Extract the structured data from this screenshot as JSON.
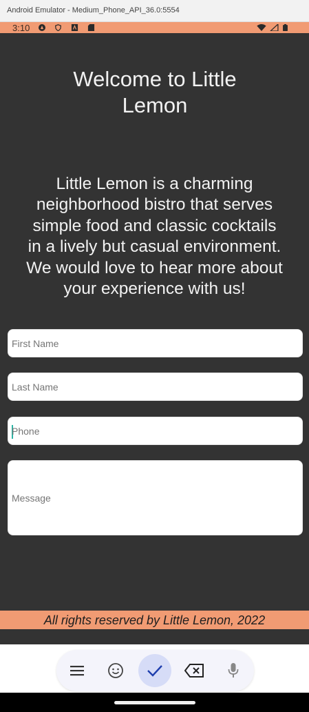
{
  "window": {
    "title": "Android Emulator - Medium_Phone_API_36.0:5554"
  },
  "status_bar": {
    "time": "3:10",
    "color": "#f19b73"
  },
  "screen": {
    "welcome_line1": "Welcome to Little",
    "welcome_line2": "Lemon",
    "intro_lines": [
      "Little Lemon is a charming",
      "neighborhood bistro that serves",
      "simple food and classic cocktails",
      "in a lively but casual environment.",
      "We would love to hear more about",
      "your experience with us!"
    ],
    "fields": {
      "first_name": "First Name",
      "last_name": "Last Name",
      "phone": "Phone",
      "message": "Message"
    },
    "focused_field": "phone",
    "footer": "All rights reserved by Little Lemon, 2022"
  },
  "keyboard_toolbar": {
    "buttons": [
      "menu-icon",
      "emoji-icon",
      "checkmark-icon",
      "backspace-icon",
      "microphone-icon"
    ],
    "accent": "#d6dcf7"
  },
  "colors": {
    "background": "#333333",
    "accent": "#f19b73",
    "cursor": "#2bb5a5"
  }
}
